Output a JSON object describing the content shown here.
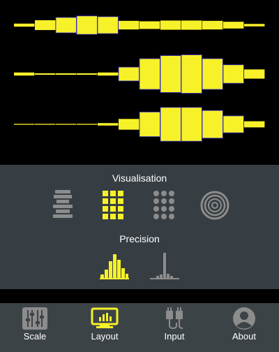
{
  "visualisation_display": {
    "rows": [
      {
        "values": [
          0.1,
          0.32,
          0.5,
          0.6,
          0.55,
          0.28,
          0.25,
          0.3,
          0.3,
          0.28,
          0.22,
          0.08
        ]
      },
      {
        "values": [
          0.1,
          0.05,
          0.05,
          0.05,
          0.1,
          0.45,
          1.0,
          1.2,
          1.25,
          1.0,
          0.6,
          0.3
        ]
      },
      {
        "values": [
          0.03,
          0.03,
          0.03,
          0.03,
          0.08,
          0.35,
          0.8,
          1.1,
          1.1,
          0.9,
          0.55,
          0.2
        ]
      }
    ],
    "bar_color": "#f7f12a",
    "edge_color": "#3a2fd0"
  },
  "settings": {
    "visualisation": {
      "title": "Visualisation",
      "options": [
        {
          "icon": "stack-bars-icon",
          "selected": false
        },
        {
          "icon": "square-grid-icon",
          "selected": true
        },
        {
          "icon": "dot-grid-icon",
          "selected": false
        },
        {
          "icon": "concentric-circles-icon",
          "selected": false
        }
      ]
    },
    "precision": {
      "title": "Precision",
      "options": [
        {
          "icon": "wide-histogram-icon",
          "selected": true
        },
        {
          "icon": "narrow-histogram-icon",
          "selected": false
        }
      ]
    }
  },
  "tabs": [
    {
      "label": "Scale",
      "icon": "sliders-icon",
      "active": false
    },
    {
      "label": "Layout",
      "icon": "monitor-chart-icon",
      "active": true
    },
    {
      "label": "Input",
      "icon": "audio-plugs-icon",
      "active": false
    },
    {
      "label": "About",
      "icon": "person-icon",
      "active": false
    }
  ],
  "colors": {
    "accent": "#f7f12a",
    "inactive": "#8c8c8c",
    "panel": "#373e43",
    "bar": "#3c4347"
  }
}
